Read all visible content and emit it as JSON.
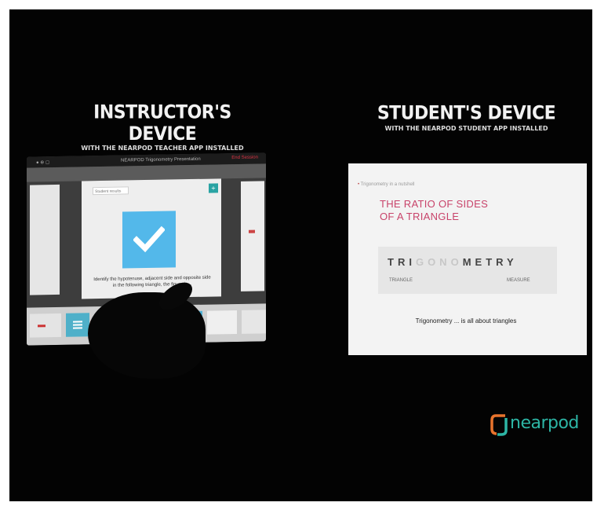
{
  "instructor": {
    "heading": "INSTRUCTOR'S DEVICE",
    "subheading": "WITH THE NEARPOD TEACHER APP INSTALLED",
    "status_left": "● ⊕ ◻",
    "status_title": "NEARPOD Trigonometry Presentation",
    "status_right": "End Session",
    "slide_tab": "Student results",
    "question": "Identify the hypotenuse, adjacent side and opposite side in the following triangle, the figure is..."
  },
  "student": {
    "heading": "STUDENT'S DEVICE",
    "subheading": "WITH THE NEARPOD STUDENT APP INSTALLED",
    "tagline": "Trigonometry in a nutshell",
    "title_line1": "THE RATIO OF SIDES",
    "title_line2": "OF A TRIANGLE",
    "word_part1": "TRI",
    "word_part2": "GONO",
    "word_part3": "METRY",
    "left_label": "TRIANGLE",
    "right_label": "MEASURE",
    "caption": "Trigonometry ... is all about triangles"
  },
  "logo": {
    "text": "nearpod",
    "color": "#2db5a5",
    "accent": "#e8732c"
  }
}
